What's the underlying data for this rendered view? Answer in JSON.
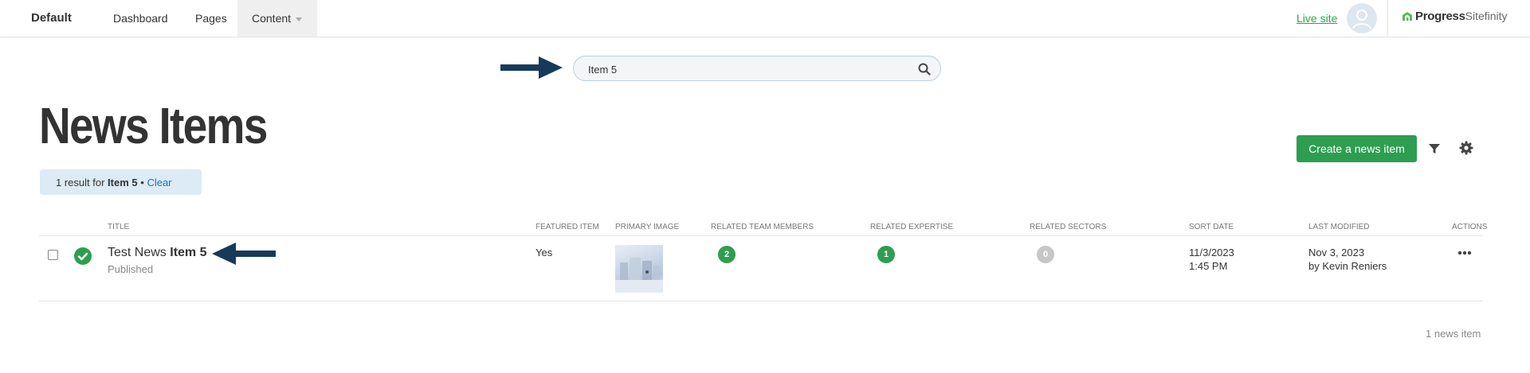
{
  "topbar": {
    "site_name": "Default",
    "nav": [
      "Dashboard",
      "Pages",
      "Content"
    ],
    "live_site": "Live site",
    "brand_name": "Progress",
    "brand_product": "Sitefinity"
  },
  "search": {
    "value": "Item 5"
  },
  "page": {
    "title": "News Items",
    "result_prefix": "1 result for",
    "result_term": "Item 5",
    "result_separator": "•",
    "clear_label": "Clear",
    "create_button": "Create a news item"
  },
  "table": {
    "columns": [
      "Title",
      "Featured item",
      "Primary image",
      "Related team members",
      "Related expertise",
      "Related sectors",
      "Sort date",
      "Last modified",
      "Actions"
    ],
    "rows": [
      {
        "title_prefix": "Test News",
        "title_bold": "Item 5",
        "status": "Published",
        "featured": "Yes",
        "team_members": "2",
        "expertise": "1",
        "sectors": "0",
        "sort_date": "11/3/2023",
        "sort_time": "1:45 PM",
        "modified_date": "Nov 3, 2023",
        "modified_by": "by Kevin Reniers"
      }
    ],
    "footer": "1 news item"
  },
  "colors": {
    "accent_green": "#2d9e4f",
    "arrow_navy": "#173a5a",
    "link_blue": "#1e6fbf",
    "badge_bg": "#dcebf5"
  },
  "icons": [
    "search-icon",
    "filter-icon",
    "gear-icon",
    "check-circle-icon",
    "more-horizontal-icon",
    "user-avatar-icon",
    "arrow-right-icon",
    "arrow-left-icon"
  ]
}
